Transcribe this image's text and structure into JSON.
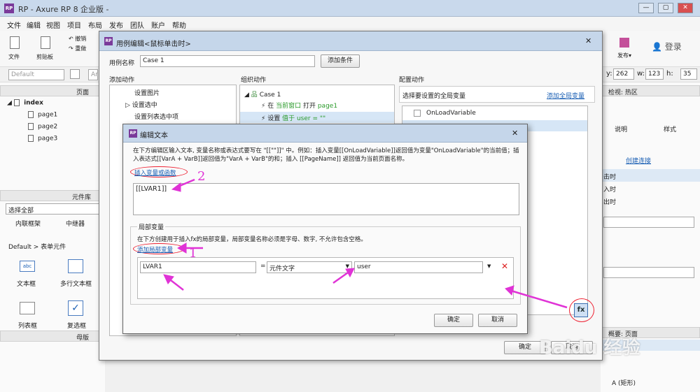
{
  "app": {
    "logo": "RP",
    "title": "RP - Axure RP 8 企业版 -"
  },
  "menu": [
    "文件",
    "编辑",
    "视图",
    "项目",
    "布局",
    "发布",
    "团队",
    "账户",
    "帮助"
  ],
  "toolbar": {
    "file": "文件",
    "clipboard": "剪贴板",
    "undo": "撤销",
    "redo": "重做",
    "publish": "发布▾",
    "login": "登录",
    "style_select": "Default",
    "font_select": "Ar",
    "y_label": "y:",
    "y_value": "262",
    "w_label": "w:",
    "w_value": "123",
    "h_label": "h:",
    "h_value": "35"
  },
  "left_pane": {
    "pages_title": "页面",
    "pages": [
      {
        "name": "index"
      },
      {
        "name": "page1"
      },
      {
        "name": "page2"
      },
      {
        "name": "page3"
      }
    ],
    "library_title": "元件库",
    "select_all": "选择全部",
    "widgets_row1": [
      "内联框架",
      "中继器"
    ],
    "library_group": "Default > 表单元件",
    "widgets": [
      {
        "label": "文本框",
        "icon": "text-box-icon"
      },
      {
        "label": "多行文本框",
        "icon": "textarea-icon"
      },
      {
        "label": "列表框",
        "icon": "listbox-icon"
      },
      {
        "label": "复选框",
        "icon": "checkbox-icon"
      }
    ],
    "masters_title": "母版"
  },
  "right_pane": {
    "inspector_title": "检视: 热区",
    "tabs": [
      "说明",
      "样式"
    ],
    "create_link": "创建连接",
    "events": [
      "击时",
      "入时",
      "出时"
    ],
    "outline_title": "概要: 页面",
    "outline_items": [
      "(矩形)"
    ]
  },
  "case_editor": {
    "title": "用例编辑<鼠标单击时>",
    "case_name_label": "用例名称",
    "case_name_value": "Case 1",
    "add_condition": "添加条件",
    "col_add_action": "添加动作",
    "col_org_action": "组织动作",
    "col_config_action": "配置动作",
    "actions": [
      "设置图片",
      "设置选中",
      "设置列表选中项"
    ],
    "org_case": "Case 1",
    "org_actions": [
      {
        "verb": "在",
        "detail": "当前窗口",
        "mid": " 打开 ",
        "target": "page1"
      },
      {
        "verb": "设置",
        "detail": "值于 user = \"\"",
        "mid": "",
        "target": ""
      }
    ],
    "select_global_var": "选择要设置的全局变量",
    "add_global_var": "添加全局变量",
    "global_vars": [
      "OnLoadVariable"
    ],
    "ok": "确定",
    "cancel": "取消"
  },
  "edit_text": {
    "title": "编辑文本",
    "description": "在下方编辑区输入文本, 变量名称或表达式要写在 \"[[\"\"]]\" 中。例如：插入变量[[OnLoadVariable]]返回值为变量\"OnLoadVariable\"的当前值；插入表达式[[VarA + VarB]]返回值为\"VarA + VarB\"的和；插入 [[PageName]] 返回值为当前页面名称。",
    "insert_var_link": "插入变量或函数",
    "editor_value": "[[LVAR1]]",
    "local_vars_title": "局部变量",
    "local_vars_desc": "在下方创建用于插入fx的局部变量，局部变量名称必须是字母、数字, 不允许包含空格。",
    "add_local_var_link": "添加局部变量",
    "local_var": {
      "name": "LVAR1",
      "eq": "=",
      "type": "元件文字",
      "widget": "user"
    },
    "ok": "确定",
    "cancel": "取消"
  },
  "annotations": {
    "num1": "1",
    "num2": "2",
    "fx": "fx"
  },
  "watermark": "Baidu 经验",
  "colors": {
    "accent_purple": "#7a3a9a",
    "annotation_pink": "#e033d6",
    "annotation_red": "#e22233",
    "link_blue": "#1a5fb4"
  }
}
